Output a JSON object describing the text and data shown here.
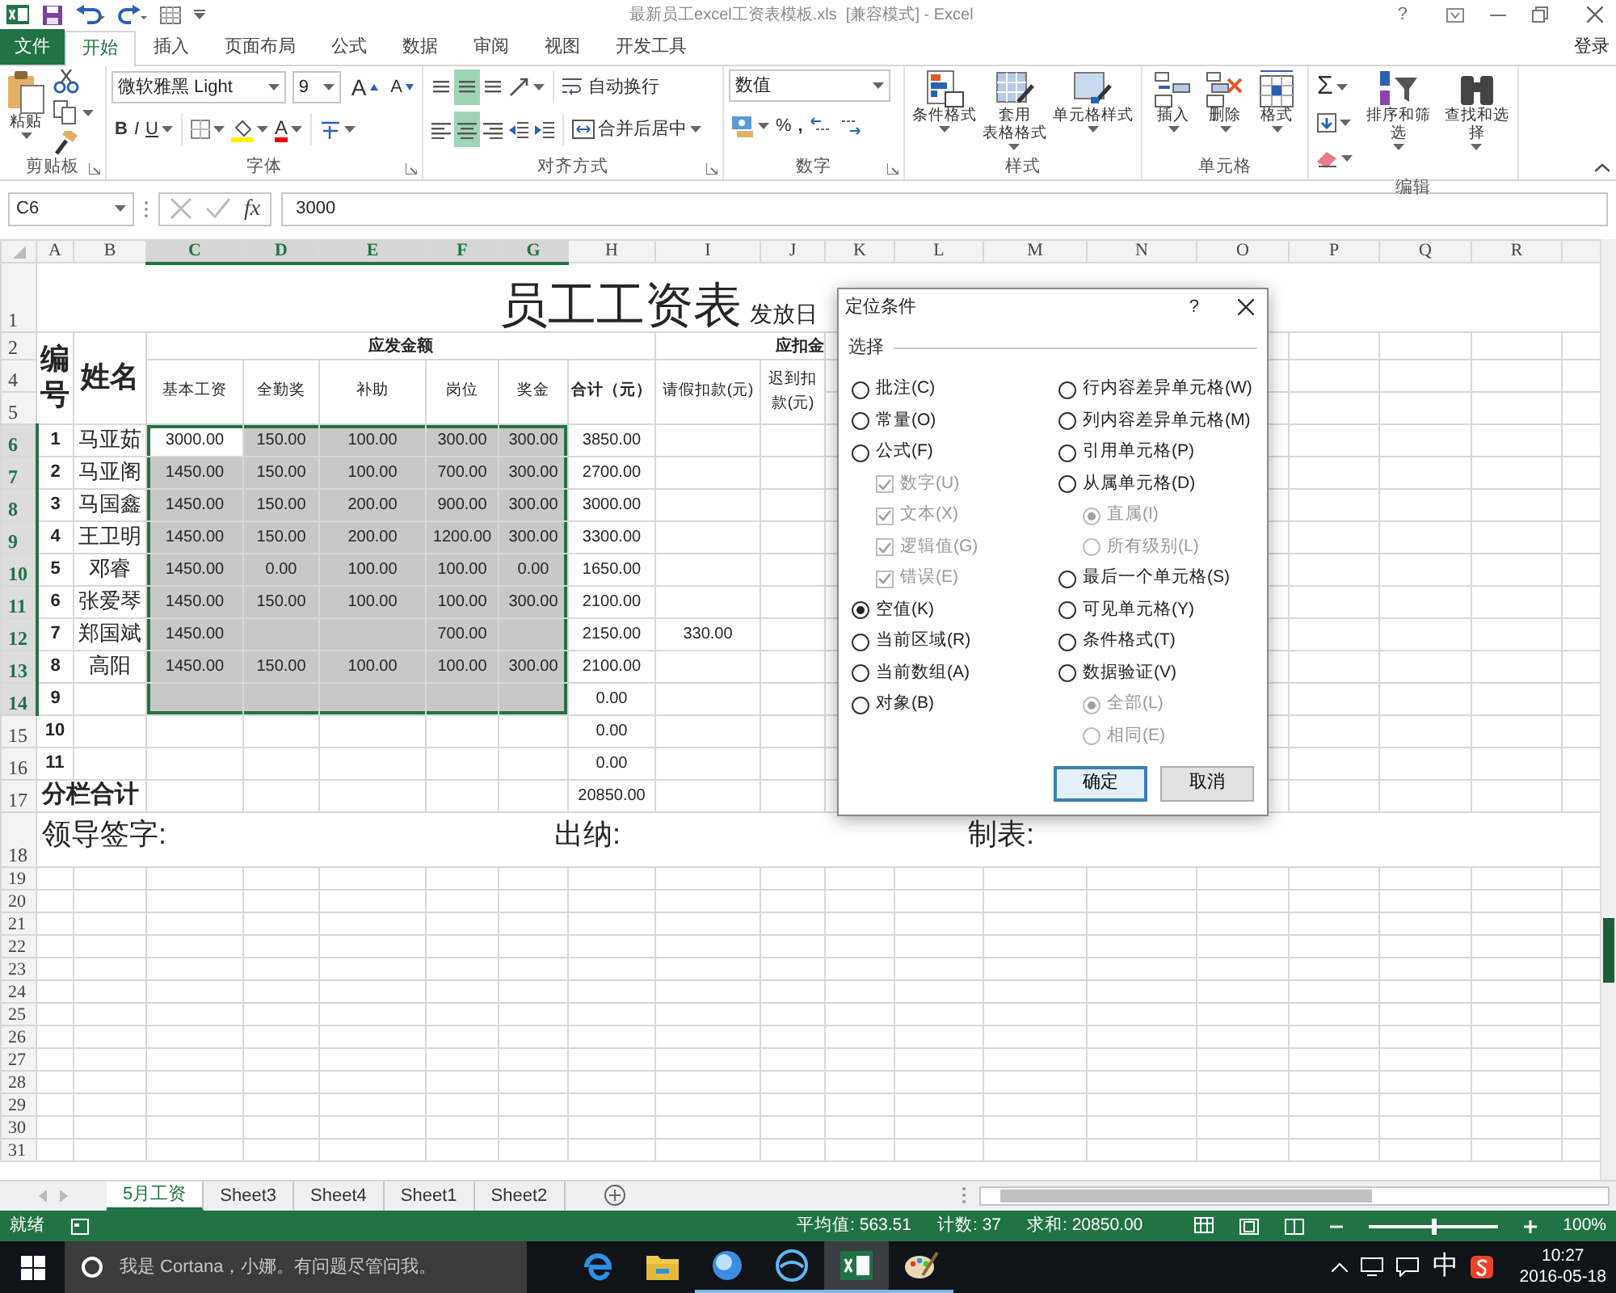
{
  "title_bar": {
    "title": "最新员工excel工资表模板.xls  [兼容模式] - Excel",
    "help": "?"
  },
  "file_tab": "文件",
  "ribbon_tabs": [
    {
      "label": "开始",
      "kind": "tab",
      "selected": true
    },
    {
      "label": "插入",
      "kind": "tab",
      "selected": false
    },
    {
      "label": "页面布局",
      "kind": "tab",
      "selected": false
    },
    {
      "label": "公式",
      "kind": "tab",
      "selected": false
    },
    {
      "label": "数据",
      "kind": "tab",
      "selected": false
    },
    {
      "label": "审阅",
      "kind": "tab",
      "selected": false
    },
    {
      "label": "视图",
      "kind": "tab",
      "selected": false
    },
    {
      "label": "开发工具",
      "kind": "tab",
      "selected": false
    }
  ],
  "sign_in": "登录",
  "ribbon": {
    "clipboard": {
      "paste": "粘贴",
      "label": "剪贴板"
    },
    "font": {
      "font_name": "微软雅黑 Light",
      "font_size": "9",
      "grow": "A",
      "shrink": "A",
      "bold": "B",
      "italic": "I",
      "underline": "U",
      "font_color": "A",
      "label": "字体"
    },
    "alignment": {
      "vertical": [
        {
          "selected": false
        },
        {
          "selected": true
        },
        {
          "selected": false
        }
      ],
      "horizontal": [
        {
          "selected": false
        },
        {
          "selected": true
        },
        {
          "selected": false
        }
      ],
      "wrap": "自动换行",
      "merge": "合并后居中",
      "label": "对齐方式"
    },
    "number": {
      "format": "数值",
      "percent": "%",
      "comma": ",",
      "label": "数字"
    },
    "styles": {
      "buttons": [
        {
          "lines": [
            "条件格式"
          ]
        },
        {
          "lines": [
            "套用",
            "表格格式"
          ]
        },
        {
          "lines": [
            "单元格样式"
          ]
        }
      ],
      "label": "样式"
    },
    "cells": {
      "buttons": [
        "插入",
        "删除",
        "格式"
      ],
      "label": "单元格"
    },
    "editing": {
      "sum": "Σ",
      "buttons": [
        "排序和筛选",
        "查找和选择"
      ],
      "label": "编辑"
    }
  },
  "formula_bar": {
    "name_box": "C6",
    "fx": "fx",
    "formula": "3000"
  },
  "sheet": {
    "columns": [
      {
        "label": "A",
        "selected": false
      },
      {
        "label": "B",
        "selected": false
      },
      {
        "label": "C",
        "selected": true
      },
      {
        "label": "D",
        "selected": true
      },
      {
        "label": "E",
        "selected": true
      },
      {
        "label": "F",
        "selected": true
      },
      {
        "label": "G",
        "selected": true
      },
      {
        "label": "H",
        "selected": false
      },
      {
        "label": "I",
        "selected": false
      },
      {
        "label": "J",
        "selected": false
      },
      {
        "label": "K",
        "selected": false
      },
      {
        "label": "L",
        "selected": false
      },
      {
        "label": "M",
        "selected": false
      },
      {
        "label": "N",
        "selected": false
      },
      {
        "label": "O",
        "selected": false
      },
      {
        "label": "P",
        "selected": false
      },
      {
        "label": "Q",
        "selected": false
      },
      {
        "label": "R",
        "selected": false
      }
    ],
    "title_row": {
      "number": "1",
      "selected": false,
      "title": "员工工资表",
      "date_label": "发放日"
    },
    "header_rows": [
      {
        "number": "2",
        "selected": false
      },
      {
        "number": "4",
        "selected": false
      },
      {
        "number": "5",
        "selected": false
      }
    ],
    "header": {
      "no": "编号",
      "name": "姓名",
      "group_1": "应发金额",
      "group_2": "应扣金",
      "subheaders": [
        "基本工资",
        "全勤奖",
        "补助",
        "岗位",
        "奖金",
        "合计（元）",
        "请假扣款(元)",
        "迟到扣款(元)"
      ]
    },
    "rows": [
      {
        "number": "6",
        "selected": true,
        "cells": [
          "1",
          "马亚茹",
          "3000.00",
          "150.00",
          "100.00",
          "300.00",
          "300.00",
          "3850.00",
          null
        ]
      },
      {
        "number": "7",
        "selected": true,
        "cells": [
          "2",
          "马亚阁",
          "1450.00",
          "150.00",
          "100.00",
          "700.00",
          "300.00",
          "2700.00",
          null
        ]
      },
      {
        "number": "8",
        "selected": true,
        "cells": [
          "3",
          "马国鑫",
          "1450.00",
          "150.00",
          "200.00",
          "900.00",
          "300.00",
          "3000.00",
          null
        ]
      },
      {
        "number": "9",
        "selected": true,
        "cells": [
          "4",
          "王卫明",
          "1450.00",
          "150.00",
          "200.00",
          "1200.00",
          "300.00",
          "3300.00",
          null
        ]
      },
      {
        "number": "10",
        "selected": true,
        "cells": [
          "5",
          "邓睿",
          "1450.00",
          "0.00",
          "100.00",
          "100.00",
          "0.00",
          "1650.00",
          null
        ]
      },
      {
        "number": "11",
        "selected": true,
        "cells": [
          "6",
          "张爱琴",
          "1450.00",
          "150.00",
          "100.00",
          "100.00",
          "300.00",
          "2100.00",
          null
        ]
      },
      {
        "number": "12",
        "selected": true,
        "cells": [
          "7",
          "郑国斌",
          "1450.00",
          null,
          null,
          "700.00",
          null,
          "2150.00",
          "330.00"
        ]
      },
      {
        "number": "13",
        "selected": true,
        "cells": [
          "8",
          "高阳",
          "1450.00",
          "150.00",
          "100.00",
          "100.00",
          "300.00",
          "2100.00",
          null
        ]
      },
      {
        "number": "14",
        "selected": true,
        "cells": [
          "9",
          null,
          null,
          null,
          null,
          null,
          null,
          "0.00",
          null
        ]
      },
      {
        "number": "15",
        "selected": false,
        "cells": [
          "10",
          null,
          null,
          null,
          null,
          null,
          null,
          "0.00",
          null
        ]
      },
      {
        "number": "16",
        "selected": false,
        "cells": [
          "11",
          null,
          null,
          null,
          null,
          null,
          null,
          "0.00",
          null
        ]
      }
    ],
    "total_row": {
      "number": "17",
      "selected": false,
      "label": "分栏合计",
      "total": "20850.00"
    },
    "sign_row": {
      "number": "18",
      "selected": false,
      "items": [
        "领导签字:",
        "出纳:",
        "制表:"
      ]
    },
    "empty_rows": [
      {
        "number": "19",
        "selected": false
      },
      {
        "number": "20",
        "selected": false
      },
      {
        "number": "21",
        "selected": false
      },
      {
        "number": "22",
        "selected": false
      },
      {
        "number": "23",
        "selected": false
      },
      {
        "number": "24",
        "selected": false
      },
      {
        "number": "25",
        "selected": false
      },
      {
        "number": "26",
        "selected": false
      },
      {
        "number": "27",
        "selected": false
      },
      {
        "number": "28",
        "selected": false
      },
      {
        "number": "29",
        "selected": false
      },
      {
        "number": "30",
        "selected": false
      },
      {
        "number": "31",
        "selected": false
      }
    ]
  },
  "dialog": {
    "title": "定位条件",
    "help": "?",
    "section": "选择",
    "left": [
      {
        "label": "批注(C)",
        "kind": "radio",
        "selected": false,
        "disabled": false
      },
      {
        "label": "常量(O)",
        "kind": "radio",
        "selected": false,
        "disabled": false
      },
      {
        "label": "公式(F)",
        "kind": "radio",
        "selected": false,
        "disabled": false,
        "children": [
          {
            "label": "数字(U)",
            "kind": "checkbox",
            "checked": true,
            "disabled": true
          },
          {
            "label": "文本(X)",
            "kind": "checkbox",
            "checked": true,
            "disabled": true
          },
          {
            "label": "逻辑值(G)",
            "kind": "checkbox",
            "checked": true,
            "disabled": true
          },
          {
            "label": "错误(E)",
            "kind": "checkbox",
            "checked": true,
            "disabled": true
          }
        ]
      },
      {
        "label": "空值(K)",
        "kind": "radio",
        "selected": true,
        "disabled": false
      },
      {
        "label": "当前区域(R)",
        "kind": "radio",
        "selected": false,
        "disabled": false
      },
      {
        "label": "当前数组(A)",
        "kind": "radio",
        "selected": false,
        "disabled": false
      },
      {
        "label": "对象(B)",
        "kind": "radio",
        "selected": false,
        "disabled": false
      }
    ],
    "right": [
      {
        "label": "行内容差异单元格(W)",
        "kind": "radio",
        "selected": false,
        "disabled": false
      },
      {
        "label": "列内容差异单元格(M)",
        "kind": "radio",
        "selected": false,
        "disabled": false
      },
      {
        "label": "引用单元格(P)",
        "kind": "radio",
        "selected": false,
        "disabled": false
      },
      {
        "label": "从属单元格(D)",
        "kind": "radio",
        "selected": false,
        "disabled": false,
        "children": [
          {
            "label": "直属(I)",
            "kind": "radio",
            "selected": true,
            "disabled": true
          },
          {
            "label": "所有级别(L)",
            "kind": "radio",
            "selected": false,
            "disabled": true
          }
        ]
      },
      {
        "label": "最后一个单元格(S)",
        "kind": "radio",
        "selected": false,
        "disabled": false
      },
      {
        "label": "可见单元格(Y)",
        "kind": "radio",
        "selected": false,
        "disabled": false
      },
      {
        "label": "条件格式(T)",
        "kind": "radio",
        "selected": false,
        "disabled": false
      },
      {
        "label": "数据验证(V)",
        "kind": "radio",
        "selected": false,
        "disabled": false,
        "children": [
          {
            "label": "全部(L)",
            "kind": "radio",
            "selected": true,
            "disabled": true
          },
          {
            "label": "相同(E)",
            "kind": "radio",
            "selected": false,
            "disabled": true
          }
        ]
      }
    ],
    "buttons": [
      {
        "label": "确定",
        "default": true
      },
      {
        "label": "取消",
        "default": false
      }
    ]
  },
  "sheet_tabs": [
    {
      "label": "5月工资",
      "selected": true
    },
    {
      "label": "Sheet3",
      "selected": false
    },
    {
      "label": "Sheet4",
      "selected": false
    },
    {
      "label": "Sheet1",
      "selected": false
    },
    {
      "label": "Sheet2",
      "selected": false
    }
  ],
  "status_bar": {
    "ready": "就绪",
    "average": "平均值: 563.51",
    "count": "计数: 37",
    "sum": "求和: 20850.00",
    "zoom": {
      "level": 0.5,
      "reading": "100%"
    }
  },
  "taskbar": {
    "search": {
      "placeholder": "我是 Cortana，小娜。有问题尽管问我。"
    },
    "apps": [
      {
        "kind": "edge",
        "selected": false,
        "running": false
      },
      {
        "kind": "folder",
        "selected": false,
        "running": false
      },
      {
        "kind": "globe",
        "selected": false,
        "running": true
      },
      {
        "kind": "app",
        "selected": false,
        "running": true
      },
      {
        "kind": "excel",
        "selected": true,
        "running": true
      },
      {
        "kind": "paint",
        "selected": false,
        "running": true
      }
    ],
    "ime": "中",
    "time": "10:27",
    "date": "2016-05-18"
  }
}
